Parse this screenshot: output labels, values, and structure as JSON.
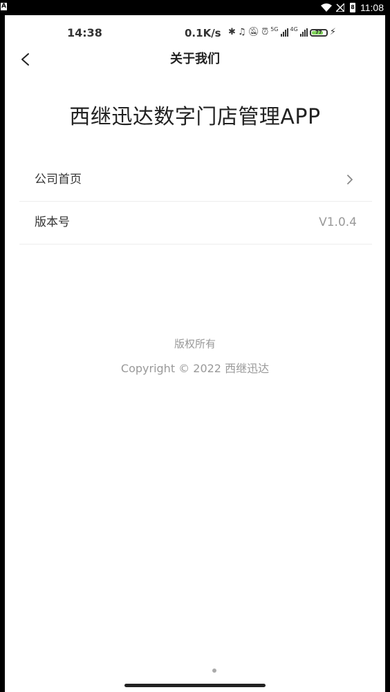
{
  "system_bar": {
    "notification_icon": "A",
    "battery_badge": "8",
    "time": "11:08",
    "icons": [
      "wifi-icon",
      "signal-off-icon",
      "battery-icon"
    ]
  },
  "inner_status_bar": {
    "time": "14:38",
    "net_speed": "0.1K/s",
    "network_5g": "5G",
    "network_4g": "4G",
    "battery_level": "77",
    "icons": [
      "bluetooth-icon",
      "headphones-icon",
      "mute-bell-icon",
      "alarm-icon",
      "signal-icon",
      "battery-icon",
      "charging-icon"
    ]
  },
  "header": {
    "title": "关于我们",
    "back_icon": "chevron-left-icon"
  },
  "app_name": "西继迅达数字门店管理APP",
  "rows": [
    {
      "label": "公司首页",
      "icon": "chevron-right-icon"
    },
    {
      "label": "版本号",
      "value": "V1.0.4"
    }
  ],
  "footer": {
    "rights": "版权所有",
    "copyright": "Copyright © 2022 西继迅达"
  },
  "colors": {
    "background": "#ffffff",
    "text_primary": "#222222",
    "text_secondary": "#999999",
    "divider": "#ededed",
    "battery_fill": "#7fd35a"
  }
}
